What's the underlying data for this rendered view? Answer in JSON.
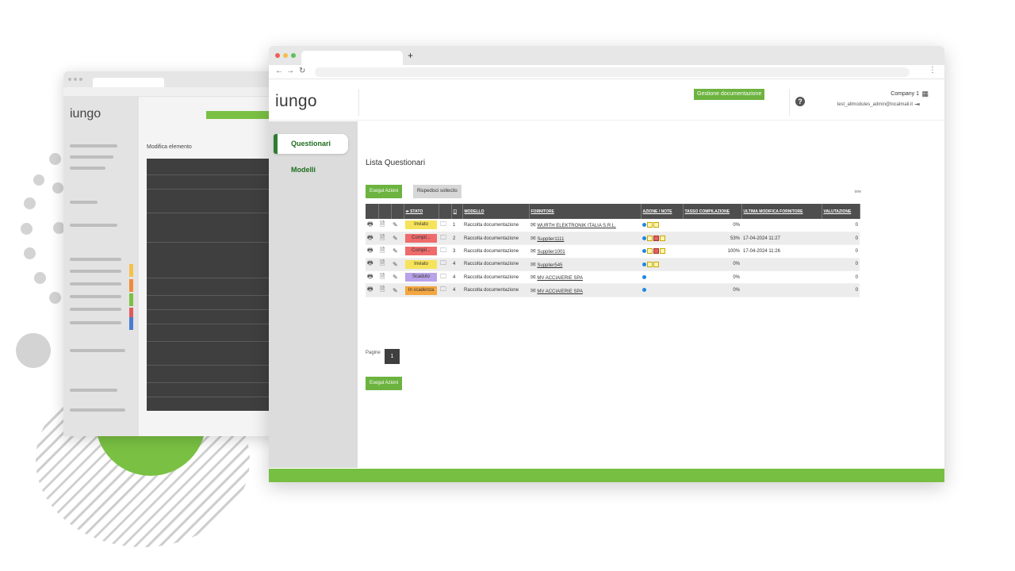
{
  "app": {
    "logo": "iungo",
    "header_button": "Gestione documentazione",
    "company": "Company 1",
    "user_email": "test_allmodules_admin@localmail.it"
  },
  "sidebar": {
    "items": [
      {
        "label": "Questionari",
        "active": true
      },
      {
        "label": "Modelli",
        "active": false
      }
    ]
  },
  "main": {
    "title": "Lista Questionari",
    "actions": {
      "run": "Esegui Azioni",
      "resend": "Rispedisci sollecito",
      "view": "one"
    },
    "table": {
      "headers": [
        "",
        "",
        "",
        "STATO",
        "",
        "",
        "MODELLO",
        "FORNITORE",
        "AZIONE / NOTE",
        "TASSO COMPILAZIONE",
        "ULTIMA MODIFICA FORNITORE",
        "VALUTAZIONE"
      ],
      "rows": [
        {
          "stato": "Inviato",
          "color": "#f6e35a",
          "num": "1",
          "modello": "Raccolta documentazione",
          "fornitore": "WURTH ELEKTRONIK ITALIA S.R.L.",
          "azioni": "yy",
          "tasso": "0%",
          "ultima": "",
          "valutazione": "0"
        },
        {
          "stato": "Compil...",
          "color": "#ef6b6b",
          "num": "2",
          "modello": "Raccolta documentazione",
          "fornitore": "Supplier1111",
          "azioni": "yry",
          "tasso": "53%",
          "ultima": "17-04-2024 11:27",
          "valutazione": "0"
        },
        {
          "stato": "Compil...",
          "color": "#ef6b6b",
          "num": "3",
          "modello": "Raccolta documentazione",
          "fornitore": "Supplier1001",
          "azioni": "yry",
          "tasso": "100%",
          "ultima": "17-04-2024 11:26",
          "valutazione": "0"
        },
        {
          "stato": "Inviato",
          "color": "#f6e35a",
          "num": "4",
          "modello": "Raccolta documentazione",
          "fornitore": "Supplier545",
          "azioni": "yy",
          "tasso": "0%",
          "ultima": "",
          "valutazione": "0"
        },
        {
          "stato": "Scaduto",
          "color": "#b9a2e8",
          "num": "4",
          "modello": "Raccolta documentazione",
          "fornitore": "MV ACCIAIERIE SPA",
          "azioni": "",
          "tasso": "0%",
          "ultima": "",
          "valutazione": "0"
        },
        {
          "stato": "In scadenza",
          "color": "#f4a640",
          "num": "4",
          "modello": "Raccolta documentazione",
          "fornitore": "MV ACCIAIERIE SPA",
          "azioni": "",
          "tasso": "0%",
          "ultima": "",
          "valutazione": "0"
        }
      ]
    },
    "pager": {
      "label": "Pagine",
      "current": "1"
    },
    "bottom_button": "Esegui Azioni"
  },
  "colors": {
    "accent": "#6cb33f",
    "dark": "#4e4e4e",
    "footer": "#76bf42"
  },
  "back_window": {
    "logo": "iungo",
    "title": "Modifica elemento"
  }
}
